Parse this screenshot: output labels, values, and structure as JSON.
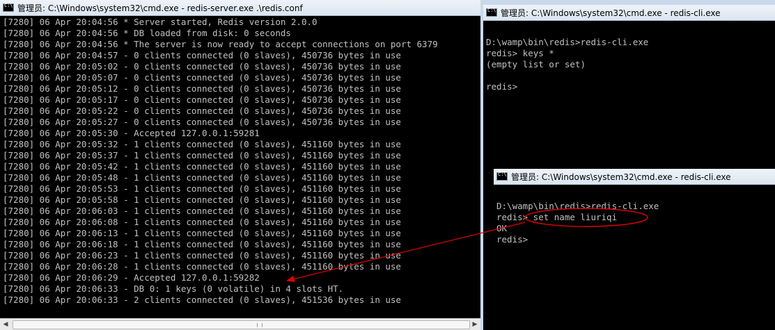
{
  "server_window": {
    "title": "管理员: C:\\Windows\\system32\\cmd.exe - redis-server.exe  .\\redis.conf",
    "lines": [
      "[7280] 06 Apr 20:04:56 * Server started, Redis version 2.0.0",
      "[7280] 06 Apr 20:04:56 * DB loaded from disk: 0 seconds",
      "[7280] 06 Apr 20:04:56 * The server is now ready to accept connections on port 6379",
      "[7280] 06 Apr 20:04:57 - 0 clients connected (0 slaves), 450736 bytes in use",
      "[7280] 06 Apr 20:05:02 - 0 clients connected (0 slaves), 450736 bytes in use",
      "[7280] 06 Apr 20:05:07 - 0 clients connected (0 slaves), 450736 bytes in use",
      "[7280] 06 Apr 20:05:12 - 0 clients connected (0 slaves), 450736 bytes in use",
      "[7280] 06 Apr 20:05:17 - 0 clients connected (0 slaves), 450736 bytes in use",
      "[7280] 06 Apr 20:05:22 - 0 clients connected (0 slaves), 450736 bytes in use",
      "[7280] 06 Apr 20:05:27 - 0 clients connected (0 slaves), 450736 bytes in use",
      "[7280] 06 Apr 20:05:30 - Accepted 127.0.0.1:59281",
      "[7280] 06 Apr 20:05:32 - 1 clients connected (0 slaves), 451160 bytes in use",
      "[7280] 06 Apr 20:05:37 - 1 clients connected (0 slaves), 451160 bytes in use",
      "[7280] 06 Apr 20:05:42 - 1 clients connected (0 slaves), 451160 bytes in use",
      "[7280] 06 Apr 20:05:48 - 1 clients connected (0 slaves), 451160 bytes in use",
      "[7280] 06 Apr 20:05:53 - 1 clients connected (0 slaves), 451160 bytes in use",
      "[7280] 06 Apr 20:05:58 - 1 clients connected (0 slaves), 451160 bytes in use",
      "[7280] 06 Apr 20:06:03 - 1 clients connected (0 slaves), 451160 bytes in use",
      "[7280] 06 Apr 20:06:08 - 1 clients connected (0 slaves), 451160 bytes in use",
      "[7280] 06 Apr 20:06:13 - 1 clients connected (0 slaves), 451160 bytes in use",
      "[7280] 06 Apr 20:06:18 - 1 clients connected (0 slaves), 451160 bytes in use",
      "[7280] 06 Apr 20:06:23 - 1 clients connected (0 slaves), 451160 bytes in use",
      "[7280] 06 Apr 20:06:28 - 1 clients connected (0 slaves), 451160 bytes in use",
      "[7280] 06 Apr 20:06:29 - Accepted 127.0.0.1:59282",
      "[7280] 06 Apr 20:06:33 - DB 0: 1 keys (0 volatile) in 4 slots HT.",
      "[7280] 06 Apr 20:06:33 - 2 clients connected (0 slaves), 451536 bytes in use"
    ]
  },
  "cli_window_top": {
    "title": "管理员: C:\\Windows\\system32\\cmd.exe - redis-cli.exe",
    "lines": [
      "",
      "D:\\wamp\\bin\\redis>redis-cli.exe",
      "redis> keys *",
      "(empty list or set)",
      "",
      "redis>"
    ]
  },
  "cli_window_bottom": {
    "title": "管理员: C:\\Windows\\system32\\cmd.exe - redis-cli.exe",
    "lines": [
      "",
      "D:\\wamp\\bin\\redis>redis-cli.exe",
      "redis> set name liuriqi",
      "OK",
      "redis>"
    ]
  },
  "colors": {
    "console_bg": "#000000",
    "console_text": "#c0c0c0",
    "annotation": "#e00000"
  },
  "icons": {
    "window_icon": "cmd-icon",
    "scroll_left": "arrow-left-icon",
    "scroll_right": "arrow-right-icon"
  }
}
